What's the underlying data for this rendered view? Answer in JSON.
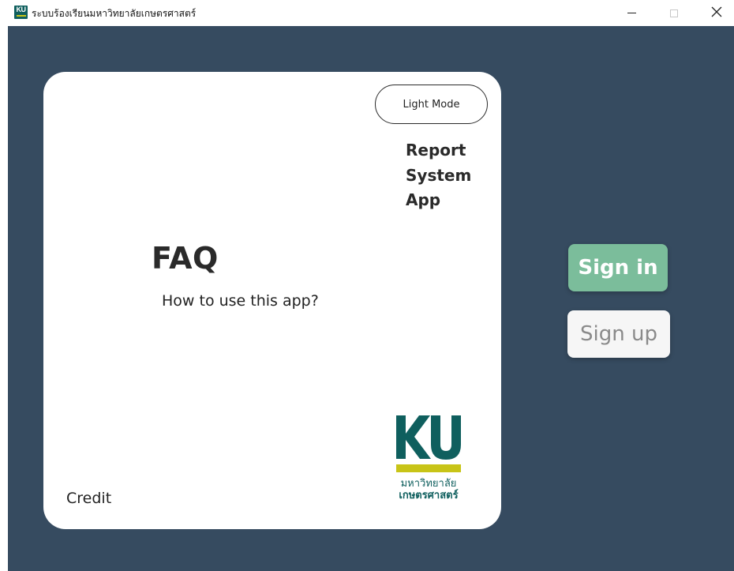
{
  "window": {
    "icon_text": "KU",
    "title": "ระบบร้องเรียนมหาวิทยาลัยเกษตรศาสตร์",
    "controls": {
      "minimize": "—",
      "maximize": "☐",
      "close": "✕"
    }
  },
  "card": {
    "light_mode_label": "Light Mode",
    "report_lines": [
      "Report",
      "System",
      "App"
    ],
    "faq_title": "FAQ",
    "faq_link": "How to use this app?",
    "credit": "Credit",
    "logo": {
      "letters": "KU",
      "line1": "มหาวิทยาลัย",
      "line2": "เกษตรศาสตร์"
    }
  },
  "auth": {
    "sign_in_label": "Sign in",
    "sign_up_label": "Sign up"
  },
  "colors": {
    "background": "#364b60",
    "card": "#ffffff",
    "sign_in": "#7bbd9b",
    "sign_up": "#f6f6f6",
    "ku_green": "#0f5f5e",
    "ku_yellow": "#c8c417"
  }
}
